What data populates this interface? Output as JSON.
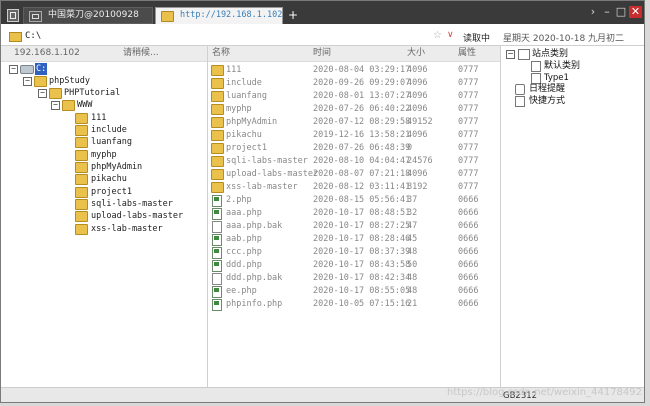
{
  "tabs": [
    {
      "label": "中国菜刀@20100928"
    },
    {
      "label": "http://192.168.1.102/a..."
    }
  ],
  "titlebar": {
    "new_tab": "+",
    "chevron": "›",
    "min": "–",
    "max": "□",
    "close": "✕"
  },
  "address": {
    "path": "C:\\",
    "star": "☆",
    "dropdown": "∨",
    "read_button": "读取中",
    "date": "星期天 2020-10-18 九月初二"
  },
  "left_header": {
    "ip": "192.168.1.102",
    "status": "请稍候..."
  },
  "file_headers": {
    "name": "名称",
    "time": "时间",
    "size": "大小",
    "attr": "属性"
  },
  "tree": {
    "drive": "C:",
    "items": [
      "phpStudy",
      "PHPTutorial",
      "WWW",
      "111",
      "include",
      "luanfang",
      "myphp",
      "phpMyAdmin",
      "pikachu",
      "project1",
      "sqli-labs-master",
      "upload-labs-master",
      "xss-lab-master"
    ]
  },
  "files": [
    {
      "type": "folder",
      "name": "111",
      "time": "2020-08-04 03:29:17",
      "size": "4096",
      "attr": "0777"
    },
    {
      "type": "folder",
      "name": "include",
      "time": "2020-09-26 09:29:07",
      "size": "4096",
      "attr": "0777"
    },
    {
      "type": "folder",
      "name": "luanfang",
      "time": "2020-08-01 13:07:27",
      "size": "4096",
      "attr": "0777"
    },
    {
      "type": "folder",
      "name": "myphp",
      "time": "2020-07-26 06:40:22",
      "size": "4096",
      "attr": "0777"
    },
    {
      "type": "folder",
      "name": "phpMyAdmin",
      "time": "2020-07-12 08:29:58",
      "size": "49152",
      "attr": "0777"
    },
    {
      "type": "folder",
      "name": "pikachu",
      "time": "2019-12-16 13:58:21",
      "size": "4096",
      "attr": "0777"
    },
    {
      "type": "folder",
      "name": "project1",
      "time": "2020-07-26 06:48:39",
      "size": "0",
      "attr": "0777"
    },
    {
      "type": "folder",
      "name": "sqli-labs-master",
      "time": "2020-08-10 04:04:47",
      "size": "24576",
      "attr": "0777"
    },
    {
      "type": "folder",
      "name": "upload-labs-master",
      "time": "2020-08-07 07:21:18",
      "size": "4096",
      "attr": "0777"
    },
    {
      "type": "folder",
      "name": "xss-lab-master",
      "time": "2020-08-12 03:11:41",
      "size": "8192",
      "attr": "0777"
    },
    {
      "type": "php",
      "name": "2.php",
      "time": "2020-08-15 05:56:41",
      "size": "37",
      "attr": "0666"
    },
    {
      "type": "php",
      "name": "aaa.php",
      "time": "2020-10-17 08:48:51",
      "size": "32",
      "attr": "0666"
    },
    {
      "type": "bak",
      "name": "aaa.php.bak",
      "time": "2020-10-17 08:27:25",
      "size": "47",
      "attr": "0666"
    },
    {
      "type": "php",
      "name": "aab.php",
      "time": "2020-10-17 08:28:46",
      "size": "45",
      "attr": "0666"
    },
    {
      "type": "php",
      "name": "ccc.php",
      "time": "2020-10-17 08:37:39",
      "size": "48",
      "attr": "0666"
    },
    {
      "type": "php",
      "name": "ddd.php",
      "time": "2020-10-17 08:43:58",
      "size": "50",
      "attr": "0666"
    },
    {
      "type": "bak",
      "name": "ddd.php.bak",
      "time": "2020-10-17 08:42:34",
      "size": "48",
      "attr": "0666"
    },
    {
      "type": "php",
      "name": "ee.php",
      "time": "2020-10-17 08:55:05",
      "size": "48",
      "attr": "0666"
    },
    {
      "type": "php",
      "name": "phpinfo.php",
      "time": "2020-10-05 07:15:16",
      "size": "21",
      "attr": "0666"
    }
  ],
  "right_panel": {
    "site_category": "站点类别",
    "default_category": "默认类别",
    "type1": "Type1",
    "schedule": "日程提醒",
    "shortcuts": "快捷方式"
  },
  "status": {
    "encoding": "GB2312"
  },
  "watermark": "https://blog.csdn.net/weixin_44178492"
}
